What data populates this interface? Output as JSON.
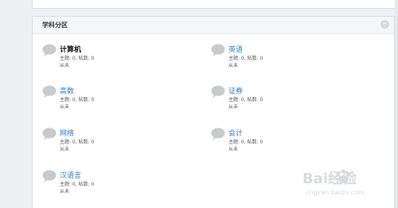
{
  "section": {
    "title": "学科分区",
    "collapse_icon": "collapse-icon"
  },
  "forums": [
    {
      "name": "计算机",
      "stats": "主题: 0, 帖数: 0",
      "last": "从未",
      "bold": true
    },
    {
      "name": "英语",
      "stats": "主题: 0, 帖数: 0",
      "last": "从未",
      "bold": false
    },
    {
      "name": "高数",
      "stats": "主题: 0, 帖数: 0",
      "last": "从未",
      "bold": false
    },
    {
      "name": "证券",
      "stats": "主题: 0, 帖数: 0",
      "last": "从未",
      "bold": false
    },
    {
      "name": "网络",
      "stats": "主题: 0, 帖数: 0",
      "last": "从未",
      "bold": false
    },
    {
      "name": "会计",
      "stats": "主题: 0, 帖数: 0",
      "last": "从未",
      "bold": false
    },
    {
      "name": "汉语言",
      "stats": "主题: 0, 帖数: 0",
      "last": "从未",
      "bold": false
    }
  ],
  "watermark": {
    "text": "Bai经验",
    "url": "jingyan.baidu.com"
  },
  "colors": {
    "link": "#2a7bc0",
    "icon": "#c8cacc"
  }
}
